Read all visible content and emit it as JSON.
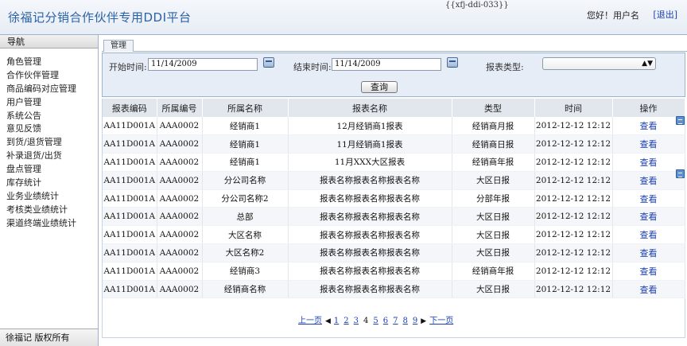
{
  "header": {
    "title": "徐福记分销合作伙伴专用DDI平台",
    "page_code": "{{xfj-ddi-033}}",
    "greeting": "您好！用户名",
    "logout": "[退出]"
  },
  "sidebar": {
    "heading": "导航",
    "items": [
      {
        "label": "角色管理"
      },
      {
        "label": "合作伙伴管理"
      },
      {
        "label": "商品编码对应管理"
      },
      {
        "label": "用户管理"
      },
      {
        "label": "系统公告"
      },
      {
        "label": "意见反馈"
      },
      {
        "label": "到货/退货管理"
      },
      {
        "label": "补录退货/出货"
      },
      {
        "label": "盘点管理"
      },
      {
        "label": "库存统计"
      },
      {
        "label": "业务业绩统计"
      },
      {
        "label": "考核类业绩统计"
      },
      {
        "label": "渠道终端业绩统计"
      }
    ],
    "copyright": "徐福记 版权所有"
  },
  "main": {
    "tab": "管理",
    "filter": {
      "start_label": "开始时间:",
      "start_value": "11/14/2009",
      "end_label": "结束时间:",
      "end_value": "11/14/2009",
      "type_label": "报表类型:",
      "type_value": "",
      "query_button": "查询"
    },
    "table": {
      "headers": [
        "报表编码",
        "所属编号",
        "所属名称",
        "报表名称",
        "类型",
        "时间",
        "操作"
      ],
      "rows": [
        {
          "code": "AA11D001A",
          "owner_no": "AAA0002",
          "owner_name": "经销商1",
          "report": "12月经销商1报表",
          "type": "经销商月报",
          "time": "2012-12-12 12:12",
          "action": "查看"
        },
        {
          "code": "AA11D001A",
          "owner_no": "AAA0002",
          "owner_name": "经销商1",
          "report": "11月经销商1报表",
          "type": "经销商日报",
          "time": "2012-12-12 12:12",
          "action": "查看"
        },
        {
          "code": "AA11D001A",
          "owner_no": "AAA0002",
          "owner_name": "经销商1",
          "report": "11月XXX大区报表",
          "type": "经销商年报",
          "time": "2012-12-12 12:12",
          "action": "查看"
        },
        {
          "code": "AA11D001A",
          "owner_no": "AAA0002",
          "owner_name": "分公司名称",
          "report": "报表名称报表名称报表名称",
          "type": "大区日报",
          "time": "2012-12-12 12:12",
          "action": "查看"
        },
        {
          "code": "AA11D001A",
          "owner_no": "AAA0002",
          "owner_name": "分公司名称2",
          "report": "报表名称报表名称报表名称",
          "type": "分部年报",
          "time": "2012-12-12 12:12",
          "action": "查看"
        },
        {
          "code": "AA11D001A",
          "owner_no": "AAA0002",
          "owner_name": "总部",
          "report": "报表名称报表名称报表名称",
          "type": "大区日报",
          "time": "2012-12-12 12:12",
          "action": "查看"
        },
        {
          "code": "AA11D001A",
          "owner_no": "AAA0002",
          "owner_name": "大区名称",
          "report": "报表名称报表名称报表名称",
          "type": "大区日报",
          "time": "2012-12-12 12:12",
          "action": "查看"
        },
        {
          "code": "AA11D001A",
          "owner_no": "AAA0002",
          "owner_name": "大区名称2",
          "report": "报表名称报表名称报表名称",
          "type": "大区日报",
          "time": "2012-12-12 12:12",
          "action": "查看"
        },
        {
          "code": "AA11D001A",
          "owner_no": "AAA0002",
          "owner_name": "经销商3",
          "report": "报表名称报表名称报表名称",
          "type": "经销商年报",
          "time": "2012-12-12 12:12",
          "action": "查看"
        },
        {
          "code": "AA11D001A",
          "owner_no": "AAA0002",
          "owner_name": "经销商名称",
          "report": "报表名称报表名称报表名称",
          "type": "大区日报",
          "time": "2012-12-12 12:12",
          "action": "查看"
        }
      ]
    },
    "pagination": {
      "prev": "上一页",
      "pages": [
        "1",
        "2",
        "3",
        "4",
        "5",
        "6",
        "7",
        "8",
        "9"
      ],
      "current": "4",
      "next": "下一页"
    },
    "icons": {
      "calendar": "calendar-icon",
      "side": "list-icon",
      "dropdown": "up-down-arrows-icon"
    }
  }
}
